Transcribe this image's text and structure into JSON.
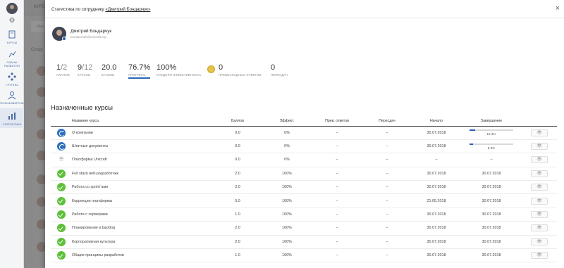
{
  "nav": {
    "items": [
      {
        "label": "КУРСЫ",
        "icon": "book-icon"
      },
      {
        "label": "ПЛАНЫ РАЗВИТИЯ",
        "icon": "plan-icon"
      },
      {
        "label": "ГРУППЫ",
        "icon": "groups-icon"
      },
      {
        "label": "ПОЛЬЗОВАТЕЛИ",
        "icon": "users-icon"
      },
      {
        "label": "СТАТИСТИКА",
        "icon": "stats-icon"
      }
    ]
  },
  "background": {
    "topbar_label": "КУРС",
    "search_placeholder": "Имя",
    "tab_label": "Сотру"
  },
  "modal": {
    "title_prefix": "Статистика по сотруднику",
    "title_link": "«Дмитрий Бондарчук»",
    "close_label": "×"
  },
  "user": {
    "name": "Дмитрий Бондарчук",
    "email": "bondarchuk@unicraft.org"
  },
  "stats": [
    {
      "main": "1",
      "sub": "/2",
      "label": "ПЛАНОВ"
    },
    {
      "main": "9",
      "sub": "/12",
      "label": "КУРСОВ"
    },
    {
      "main": "20.0",
      "sub": "",
      "label": "БАЛЛОВ"
    },
    {
      "main": "76.7%",
      "sub": "",
      "label": "ПРОГРЕСС"
    },
    {
      "main": "100%",
      "sub": "",
      "label": "СРЕДНЯЯ ЭФФЕКТИВНОСТЬ"
    },
    {
      "main": "0",
      "sub": "",
      "label": "ПРЕВОСХОДНЫХ ОТВЕТОВ"
    },
    {
      "main": "0",
      "sub": "",
      "label": "ПЕРЕСДАЧ"
    }
  ],
  "progress_fraction": 0.767,
  "section_title": "Назначенные курсы",
  "table": {
    "headers": [
      "",
      "Название курса",
      "Баллов",
      "Эффект.",
      "Прев. ответов",
      "Пересдач",
      "Начало",
      "Завершение",
      ""
    ],
    "rows": [
      {
        "status": "blue",
        "name": "О компании",
        "score": "0.0",
        "eff": "0%",
        "exc": "–",
        "retakes": "–",
        "start": "30.07.2018",
        "progress_fraction": 0.123,
        "end": "12.3%"
      },
      {
        "status": "blue",
        "name": "Штатные документы",
        "score": "0.0",
        "eff": "0%",
        "exc": "–",
        "retakes": "–",
        "start": "30.07.2018",
        "progress_fraction": 0.083,
        "end": "8.3%"
      },
      {
        "status": "grey",
        "name": "Платформа Unicraft",
        "score": "0.0",
        "eff": "0%",
        "exc": "–",
        "retakes": "–",
        "start": "–",
        "end": "–"
      },
      {
        "status": "green",
        "name": "Full stack веб-разработчик",
        "score": "2.0",
        "eff": "100%",
        "exc": "–",
        "retakes": "–",
        "start": "30.07.2018",
        "end": "30.07.2018"
      },
      {
        "status": "green",
        "name": "Работа со sprint`ами",
        "score": "2.0",
        "eff": "100%",
        "exc": "–",
        "retakes": "–",
        "start": "30.07.2018",
        "end": "30.07.2018"
      },
      {
        "status": "green",
        "name": "Коррекция платформы",
        "score": "5.0",
        "eff": "100%",
        "exc": "–",
        "retakes": "–",
        "start": "21.05.2018",
        "end": "30.07.2018"
      },
      {
        "status": "green",
        "name": "Работа с серверами",
        "score": "1.0",
        "eff": "100%",
        "exc": "–",
        "retakes": "–",
        "start": "30.07.2018",
        "end": "30.07.2018"
      },
      {
        "status": "green",
        "name": "Планирование в backlog",
        "score": "2.0",
        "eff": "100%",
        "exc": "–",
        "retakes": "–",
        "start": "30.07.2018",
        "end": "30.07.2018"
      },
      {
        "status": "green",
        "name": "Корпоративная культура",
        "score": "2.0",
        "eff": "100%",
        "exc": "–",
        "retakes": "–",
        "start": "30.07.2018",
        "end": "30.07.2018"
      },
      {
        "status": "green",
        "name": "Общие принципы разработки",
        "score": "1.0",
        "eff": "100%",
        "exc": "–",
        "retakes": "–",
        "start": "30.07.2018",
        "end": "30.07.2018"
      }
    ],
    "view_label": "👁"
  }
}
